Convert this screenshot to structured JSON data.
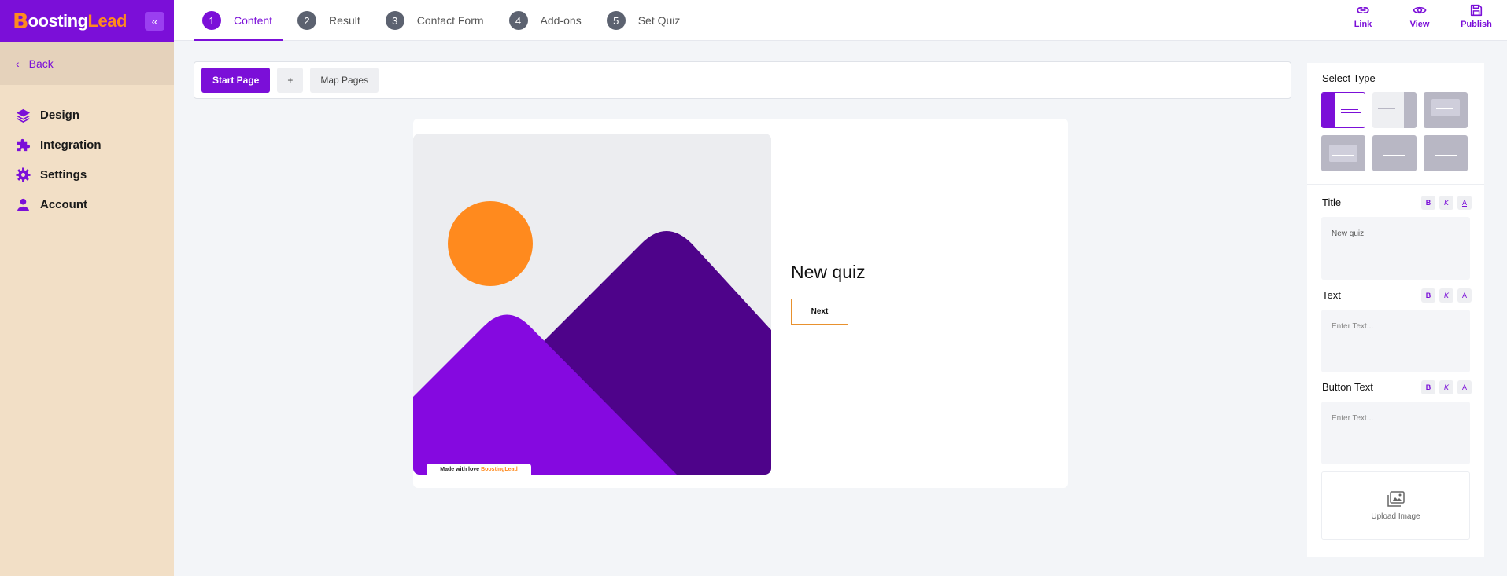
{
  "brand": {
    "logo_mark": "B",
    "logo_word_1": "oosting",
    "logo_word_2": "Lead",
    "collapse_glyph": "«"
  },
  "sidebar": {
    "back_label": "Back",
    "items": [
      {
        "label": "Design",
        "icon": "layers-icon"
      },
      {
        "label": "Integration",
        "icon": "puzzle-icon"
      },
      {
        "label": "Settings",
        "icon": "gear-icon"
      },
      {
        "label": "Account",
        "icon": "user-icon"
      }
    ]
  },
  "steps": [
    {
      "num": "1",
      "label": "Content",
      "active": true
    },
    {
      "num": "2",
      "label": "Result"
    },
    {
      "num": "3",
      "label": "Contact Form"
    },
    {
      "num": "4",
      "label": "Add-ons"
    },
    {
      "num": "5",
      "label": "Set Quiz"
    }
  ],
  "actions": {
    "link": "Link",
    "view": "View",
    "publish": "Publish"
  },
  "pagebar": {
    "start_page": "Start Page",
    "add": "+",
    "map_pages": "Map Pages"
  },
  "canvas": {
    "title": "New quiz",
    "button": "Next",
    "made_with": "Made with love",
    "made_with_brand": "BoostingLead"
  },
  "panel": {
    "select_type": "Select Type",
    "title_label": "Title",
    "title_value": "New quiz",
    "text_label": "Text",
    "text_placeholder": "Enter Text...",
    "button_text_label": "Button Text",
    "button_text_placeholder": "Enter Text...",
    "upload_label": "Upload Image",
    "format": {
      "bold": "B",
      "italic": "K",
      "color": "A"
    }
  },
  "colors": {
    "accent": "#7b0fd8",
    "brand_orange": "#ff8a1e",
    "sidebar_bg": "#f2dfc6"
  }
}
